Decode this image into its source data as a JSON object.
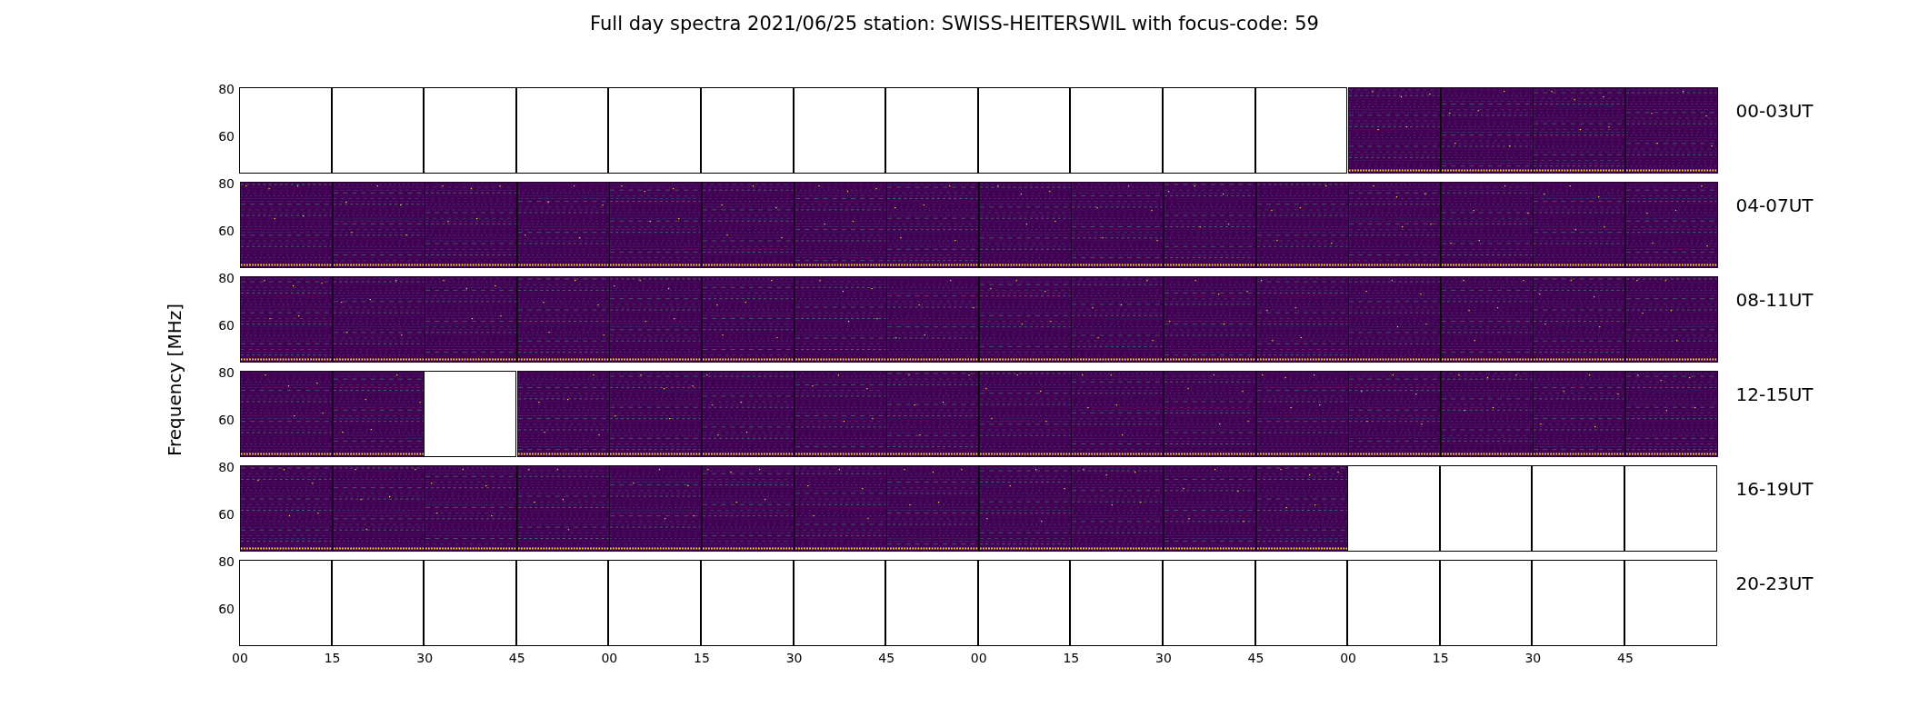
{
  "title": "Full day spectra 2021/06/25 station: SWISS-HEITERSWIL with focus-code: 59",
  "ylabel": "Frequency [MHz]",
  "rows": [
    {
      "label": "00-03UT",
      "yticks": [
        "80",
        "60"
      ],
      "panels": [
        {
          "kind": "empty"
        },
        {
          "kind": "empty"
        },
        {
          "kind": "empty"
        },
        {
          "kind": "empty"
        },
        {
          "kind": "empty"
        },
        {
          "kind": "empty"
        },
        {
          "kind": "empty"
        },
        {
          "kind": "empty"
        },
        {
          "kind": "empty"
        },
        {
          "kind": "empty"
        },
        {
          "kind": "empty"
        },
        {
          "kind": "empty"
        },
        {
          "kind": "spectrum"
        },
        {
          "kind": "spectrum"
        },
        {
          "kind": "spectrum"
        },
        {
          "kind": "spectrum"
        }
      ]
    },
    {
      "label": "04-07UT",
      "yticks": [
        "80",
        "60"
      ],
      "panels": [
        {
          "kind": "spectrum"
        },
        {
          "kind": "spectrum"
        },
        {
          "kind": "spectrum"
        },
        {
          "kind": "spectrum"
        },
        {
          "kind": "spectrum"
        },
        {
          "kind": "spectrum"
        },
        {
          "kind": "spectrum"
        },
        {
          "kind": "spectrum"
        },
        {
          "kind": "spectrum"
        },
        {
          "kind": "spectrum"
        },
        {
          "kind": "spectrum"
        },
        {
          "kind": "spectrum"
        },
        {
          "kind": "spectrum"
        },
        {
          "kind": "spectrum"
        },
        {
          "kind": "spectrum"
        },
        {
          "kind": "spectrum"
        }
      ]
    },
    {
      "label": "08-11UT",
      "yticks": [
        "80",
        "60"
      ],
      "panels": [
        {
          "kind": "spectrum"
        },
        {
          "kind": "spectrum"
        },
        {
          "kind": "spectrum"
        },
        {
          "kind": "spectrum"
        },
        {
          "kind": "spectrum"
        },
        {
          "kind": "spectrum"
        },
        {
          "kind": "spectrum"
        },
        {
          "kind": "spectrum"
        },
        {
          "kind": "spectrum"
        },
        {
          "kind": "spectrum"
        },
        {
          "kind": "spectrum"
        },
        {
          "kind": "spectrum"
        },
        {
          "kind": "spectrum"
        },
        {
          "kind": "spectrum"
        },
        {
          "kind": "spectrum"
        },
        {
          "kind": "spectrum"
        }
      ]
    },
    {
      "label": "12-15UT",
      "yticks": [
        "80",
        "60"
      ],
      "panels": [
        {
          "kind": "spectrum"
        },
        {
          "kind": "spectrum"
        },
        {
          "kind": "empty"
        },
        {
          "kind": "spectrum"
        },
        {
          "kind": "spectrum"
        },
        {
          "kind": "spectrum"
        },
        {
          "kind": "spectrum"
        },
        {
          "kind": "spectrum"
        },
        {
          "kind": "spectrum"
        },
        {
          "kind": "spectrum"
        },
        {
          "kind": "spectrum"
        },
        {
          "kind": "spectrum"
        },
        {
          "kind": "spectrum"
        },
        {
          "kind": "spectrum"
        },
        {
          "kind": "spectrum"
        },
        {
          "kind": "spectrum"
        }
      ]
    },
    {
      "label": "16-19UT",
      "yticks": [
        "80",
        "60"
      ],
      "panels": [
        {
          "kind": "spectrum"
        },
        {
          "kind": "spectrum"
        },
        {
          "kind": "spectrum"
        },
        {
          "kind": "spectrum"
        },
        {
          "kind": "spectrum"
        },
        {
          "kind": "spectrum"
        },
        {
          "kind": "spectrum"
        },
        {
          "kind": "spectrum"
        },
        {
          "kind": "spectrum"
        },
        {
          "kind": "spectrum"
        },
        {
          "kind": "spectrum"
        },
        {
          "kind": "spectrum"
        },
        {
          "kind": "empty"
        },
        {
          "kind": "empty"
        },
        {
          "kind": "empty"
        },
        {
          "kind": "empty"
        }
      ]
    },
    {
      "label": "20-23UT",
      "yticks": [
        "80",
        "60"
      ],
      "panels": [
        {
          "kind": "empty"
        },
        {
          "kind": "empty"
        },
        {
          "kind": "empty"
        },
        {
          "kind": "empty"
        },
        {
          "kind": "empty"
        },
        {
          "kind": "empty"
        },
        {
          "kind": "empty"
        },
        {
          "kind": "empty"
        },
        {
          "kind": "empty"
        },
        {
          "kind": "empty"
        },
        {
          "kind": "empty"
        },
        {
          "kind": "empty"
        },
        {
          "kind": "empty"
        },
        {
          "kind": "empty"
        },
        {
          "kind": "empty"
        },
        {
          "kind": "empty"
        }
      ]
    }
  ],
  "xticks": [
    "00",
    "15",
    "30",
    "45",
    "00",
    "15",
    "30",
    "45",
    "00",
    "15",
    "30",
    "45",
    "00",
    "15",
    "30",
    "45"
  ]
}
